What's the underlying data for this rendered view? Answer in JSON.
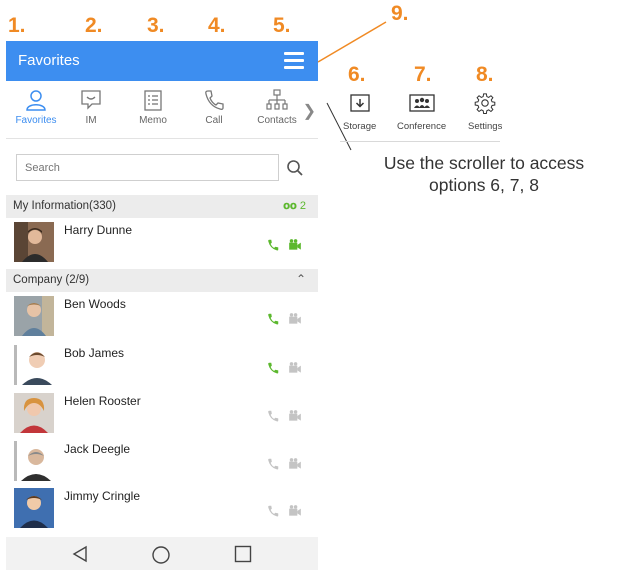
{
  "callouts": [
    "1.",
    "2.",
    "3.",
    "4.",
    "5.",
    "6.",
    "7.",
    "8.",
    "9."
  ],
  "colors": {
    "accent": "#3d8ef0",
    "callout": "#f08a24",
    "online": "#5cb82e",
    "offline": "#b5b5b5"
  },
  "header": {
    "title": "Favorites",
    "menu_icon": "hamburger-menu-icon"
  },
  "tabs": [
    {
      "label": "Favorites",
      "icon": "person-icon",
      "active": true
    },
    {
      "label": "IM",
      "icon": "chat-bubble-icon",
      "active": false
    },
    {
      "label": "Memo",
      "icon": "memo-list-icon",
      "active": false
    },
    {
      "label": "Call",
      "icon": "phone-icon",
      "active": false
    },
    {
      "label": "Contacts",
      "icon": "org-chart-icon",
      "active": false
    }
  ],
  "tab_scroller": "chevron-right-icon",
  "search": {
    "placeholder": "Search",
    "value": ""
  },
  "my_information": {
    "label": "My Information(330)",
    "count": "2",
    "contact": {
      "name": "Harry Dunne",
      "call_status": "online",
      "video_status": "online"
    }
  },
  "company": {
    "label": "Company (2/9)",
    "contacts": [
      {
        "name": "Ben Woods",
        "call_status": "online",
        "video_status": "offline"
      },
      {
        "name": "Bob James",
        "call_status": "online",
        "video_status": "offline"
      },
      {
        "name": "Helen Rooster",
        "call_status": "offline",
        "video_status": "offline"
      },
      {
        "name": "Jack Deegle",
        "call_status": "offline",
        "video_status": "offline"
      },
      {
        "name": "Jimmy Cringle",
        "call_status": "offline",
        "video_status": "offline"
      }
    ]
  },
  "nav": [
    "back-icon",
    "home-icon",
    "recents-icon"
  ],
  "extra_tabs": [
    {
      "label": "Storage",
      "icon": "storage-icon"
    },
    {
      "label": "Conference",
      "icon": "conference-icon"
    },
    {
      "label": "Settings",
      "icon": "settings-gear-icon"
    }
  ],
  "caption": {
    "line1": "Use the scroller to access",
    "line2": "options 6, 7, 8"
  }
}
